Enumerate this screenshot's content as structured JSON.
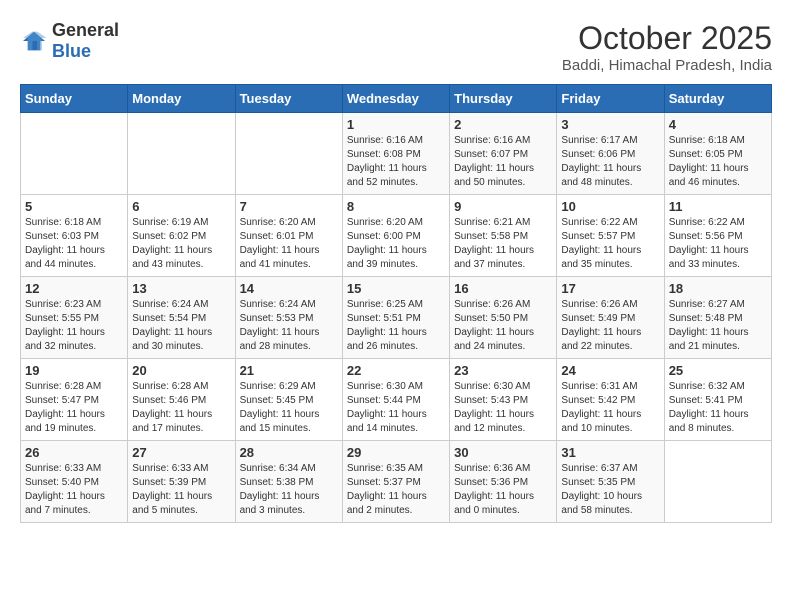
{
  "header": {
    "logo_general": "General",
    "logo_blue": "Blue",
    "month": "October 2025",
    "location": "Baddi, Himachal Pradesh, India"
  },
  "weekdays": [
    "Sunday",
    "Monday",
    "Tuesday",
    "Wednesday",
    "Thursday",
    "Friday",
    "Saturday"
  ],
  "weeks": [
    [
      {
        "day": "",
        "content": ""
      },
      {
        "day": "",
        "content": ""
      },
      {
        "day": "",
        "content": ""
      },
      {
        "day": "1",
        "content": "Sunrise: 6:16 AM\nSunset: 6:08 PM\nDaylight: 11 hours\nand 52 minutes."
      },
      {
        "day": "2",
        "content": "Sunrise: 6:16 AM\nSunset: 6:07 PM\nDaylight: 11 hours\nand 50 minutes."
      },
      {
        "day": "3",
        "content": "Sunrise: 6:17 AM\nSunset: 6:06 PM\nDaylight: 11 hours\nand 48 minutes."
      },
      {
        "day": "4",
        "content": "Sunrise: 6:18 AM\nSunset: 6:05 PM\nDaylight: 11 hours\nand 46 minutes."
      }
    ],
    [
      {
        "day": "5",
        "content": "Sunrise: 6:18 AM\nSunset: 6:03 PM\nDaylight: 11 hours\nand 44 minutes."
      },
      {
        "day": "6",
        "content": "Sunrise: 6:19 AM\nSunset: 6:02 PM\nDaylight: 11 hours\nand 43 minutes."
      },
      {
        "day": "7",
        "content": "Sunrise: 6:20 AM\nSunset: 6:01 PM\nDaylight: 11 hours\nand 41 minutes."
      },
      {
        "day": "8",
        "content": "Sunrise: 6:20 AM\nSunset: 6:00 PM\nDaylight: 11 hours\nand 39 minutes."
      },
      {
        "day": "9",
        "content": "Sunrise: 6:21 AM\nSunset: 5:58 PM\nDaylight: 11 hours\nand 37 minutes."
      },
      {
        "day": "10",
        "content": "Sunrise: 6:22 AM\nSunset: 5:57 PM\nDaylight: 11 hours\nand 35 minutes."
      },
      {
        "day": "11",
        "content": "Sunrise: 6:22 AM\nSunset: 5:56 PM\nDaylight: 11 hours\nand 33 minutes."
      }
    ],
    [
      {
        "day": "12",
        "content": "Sunrise: 6:23 AM\nSunset: 5:55 PM\nDaylight: 11 hours\nand 32 minutes."
      },
      {
        "day": "13",
        "content": "Sunrise: 6:24 AM\nSunset: 5:54 PM\nDaylight: 11 hours\nand 30 minutes."
      },
      {
        "day": "14",
        "content": "Sunrise: 6:24 AM\nSunset: 5:53 PM\nDaylight: 11 hours\nand 28 minutes."
      },
      {
        "day": "15",
        "content": "Sunrise: 6:25 AM\nSunset: 5:51 PM\nDaylight: 11 hours\nand 26 minutes."
      },
      {
        "day": "16",
        "content": "Sunrise: 6:26 AM\nSunset: 5:50 PM\nDaylight: 11 hours\nand 24 minutes."
      },
      {
        "day": "17",
        "content": "Sunrise: 6:26 AM\nSunset: 5:49 PM\nDaylight: 11 hours\nand 22 minutes."
      },
      {
        "day": "18",
        "content": "Sunrise: 6:27 AM\nSunset: 5:48 PM\nDaylight: 11 hours\nand 21 minutes."
      }
    ],
    [
      {
        "day": "19",
        "content": "Sunrise: 6:28 AM\nSunset: 5:47 PM\nDaylight: 11 hours\nand 19 minutes."
      },
      {
        "day": "20",
        "content": "Sunrise: 6:28 AM\nSunset: 5:46 PM\nDaylight: 11 hours\nand 17 minutes."
      },
      {
        "day": "21",
        "content": "Sunrise: 6:29 AM\nSunset: 5:45 PM\nDaylight: 11 hours\nand 15 minutes."
      },
      {
        "day": "22",
        "content": "Sunrise: 6:30 AM\nSunset: 5:44 PM\nDaylight: 11 hours\nand 14 minutes."
      },
      {
        "day": "23",
        "content": "Sunrise: 6:30 AM\nSunset: 5:43 PM\nDaylight: 11 hours\nand 12 minutes."
      },
      {
        "day": "24",
        "content": "Sunrise: 6:31 AM\nSunset: 5:42 PM\nDaylight: 11 hours\nand 10 minutes."
      },
      {
        "day": "25",
        "content": "Sunrise: 6:32 AM\nSunset: 5:41 PM\nDaylight: 11 hours\nand 8 minutes."
      }
    ],
    [
      {
        "day": "26",
        "content": "Sunrise: 6:33 AM\nSunset: 5:40 PM\nDaylight: 11 hours\nand 7 minutes."
      },
      {
        "day": "27",
        "content": "Sunrise: 6:33 AM\nSunset: 5:39 PM\nDaylight: 11 hours\nand 5 minutes."
      },
      {
        "day": "28",
        "content": "Sunrise: 6:34 AM\nSunset: 5:38 PM\nDaylight: 11 hours\nand 3 minutes."
      },
      {
        "day": "29",
        "content": "Sunrise: 6:35 AM\nSunset: 5:37 PM\nDaylight: 11 hours\nand 2 minutes."
      },
      {
        "day": "30",
        "content": "Sunrise: 6:36 AM\nSunset: 5:36 PM\nDaylight: 11 hours\nand 0 minutes."
      },
      {
        "day": "31",
        "content": "Sunrise: 6:37 AM\nSunset: 5:35 PM\nDaylight: 10 hours\nand 58 minutes."
      },
      {
        "day": "",
        "content": ""
      }
    ]
  ]
}
